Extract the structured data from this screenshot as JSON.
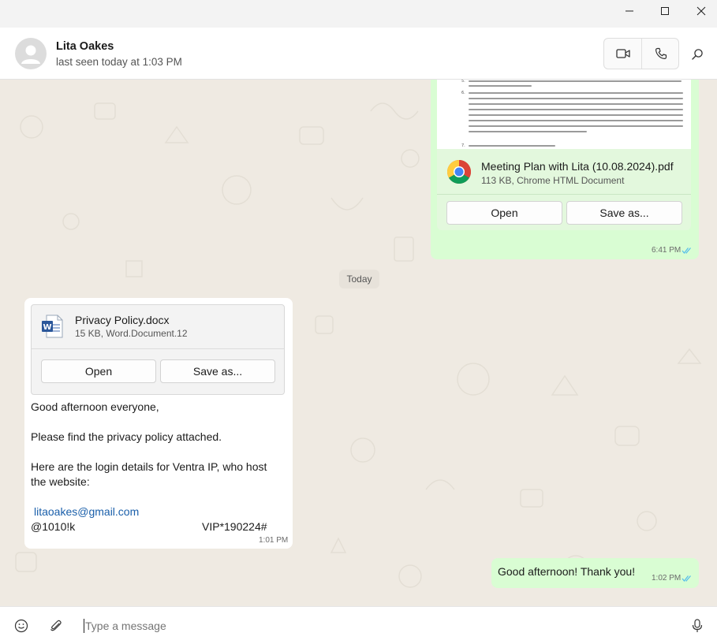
{
  "window": {
    "minimize_icon": "minimize-icon",
    "maximize_icon": "maximize-icon",
    "close_icon": "close-icon"
  },
  "header": {
    "contact_name": "Lita Oakes",
    "status": "last seen today at 1:03 PM",
    "avatar_icon": "person-avatar-icon",
    "video_icon": "video-camera-icon",
    "call_icon": "phone-icon",
    "search_icon": "search-icon"
  },
  "messages": {
    "pdf": {
      "preview_lines": [
        "Lita sent us the login and password for the WordPress admin panel. We need access to the hosting where the",
        "website files reside.",
        "Let's discuss the online chat. The main idea of online chat is to provide quick responses to website visitors,",
        "wherever the website owner is. At the last meeting, you mentioned that you most likely will not have time to",
        "be online in the chat and did not want to add too many complicated features or different places to access. To",
        "set up this online chat, we need to register for this service and install a mobile application on your phone to",
        "communicate with website visitors. We will not be able to integrate it with Aweber. The question arises",
        "whether we need online chat if, in most cases, it will simply function as a form for sending you a message to",
        "your email, which you already have on the website.",
        "Three things we did not ask about:"
      ],
      "file_name": "Meeting Plan with Lita (10.08.2024).pdf",
      "file_meta": "113 KB, Chrome HTML Document",
      "file_icon": "chrome-icon",
      "open_label": "Open",
      "save_label": "Save as...",
      "time": "6:41 PM"
    },
    "date_chip": "Today",
    "docx": {
      "file_name": "Privacy Policy.docx",
      "file_meta": "15 KB, Word.Document.12",
      "file_icon": "word-document-icon",
      "open_label": "Open",
      "save_label": "Save as...",
      "greeting": "Good afternoon everyone,",
      "line2": "Please find the privacy policy attached.",
      "line3a": "Here are the login details for Ventra IP, who host",
      "line3b": "the website:",
      "email": "litaoakes@gmail.com",
      "cred_left": "@1010!k",
      "cred_right": "VIP*190224#",
      "time": "1:01 PM"
    },
    "thanks": {
      "text": "Good afternoon! Thank you!",
      "time": "1:02 PM"
    }
  },
  "composer": {
    "placeholder": "Type a message",
    "emoji_icon": "emoji-icon",
    "attach_icon": "paperclip-icon",
    "mic_icon": "microphone-icon"
  },
  "colors": {
    "outgoing_bubble": "#d9fdd3",
    "incoming_bubble": "#ffffff",
    "chat_background": "#efeae2",
    "read_ticks": "#53bdeb",
    "link": "#1a5faa"
  }
}
